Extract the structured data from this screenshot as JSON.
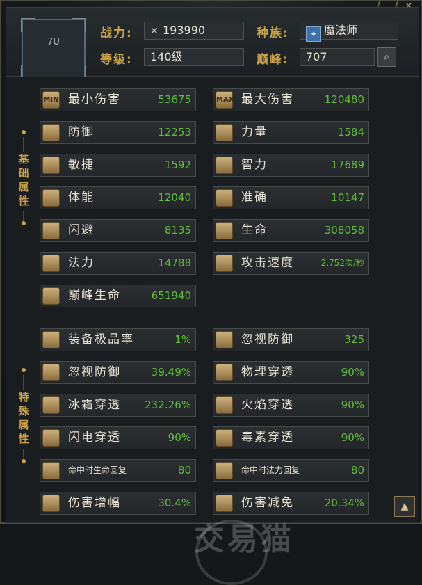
{
  "header": {
    "avatar_label": "7U",
    "power_label": "战力:",
    "power_value": "193990",
    "race_label": "种族:",
    "race_value": "魔法师",
    "level_label": "等级:",
    "level_value": "140级",
    "peak_label": "巅峰:",
    "peak_value": "707"
  },
  "sections": {
    "basic_tag": [
      "基",
      "础",
      "属",
      "性"
    ],
    "special_tag": [
      "特",
      "殊",
      "属",
      "性"
    ]
  },
  "basic_stats": [
    {
      "icon": "min-damage-icon",
      "icon_text": "MIN",
      "name": "最小伤害",
      "value": "53675"
    },
    {
      "icon": "max-damage-icon",
      "icon_text": "MAX",
      "name": "最大伤害",
      "value": "120480"
    },
    {
      "icon": "defense-icon",
      "icon_text": "",
      "name": "防御",
      "value": "12253"
    },
    {
      "icon": "strength-icon",
      "icon_text": "",
      "name": "力量",
      "value": "1584"
    },
    {
      "icon": "agility-icon",
      "icon_text": "",
      "name": "敏捷",
      "value": "1592"
    },
    {
      "icon": "intelligence-icon",
      "icon_text": "",
      "name": "智力",
      "value": "17689"
    },
    {
      "icon": "stamina-icon",
      "icon_text": "",
      "name": "体能",
      "value": "12040"
    },
    {
      "icon": "accuracy-icon",
      "icon_text": "",
      "name": "准确",
      "value": "10147"
    },
    {
      "icon": "dodge-icon",
      "icon_text": "",
      "name": "闪避",
      "value": "8135"
    },
    {
      "icon": "life-icon",
      "icon_text": "",
      "name": "生命",
      "value": "308058"
    },
    {
      "icon": "mana-icon",
      "icon_text": "",
      "name": "法力",
      "value": "14788"
    },
    {
      "icon": "attack-speed-icon",
      "icon_text": "",
      "name": "攻击速度",
      "value": "2.752次/秒"
    },
    {
      "icon": "peak-life-icon",
      "icon_text": "",
      "name": "巅峰生命",
      "value": "651940"
    }
  ],
  "special_stats": [
    {
      "icon": "equipment-rate-icon",
      "name": "装备极品率",
      "value": "1%"
    },
    {
      "icon": "ignore-defense-icon",
      "name": "忽视防御",
      "value": "325"
    },
    {
      "icon": "ignore-defense-pct-icon",
      "name": "忽视防御",
      "value": "39.49%"
    },
    {
      "icon": "physical-pierce-icon",
      "name": "物理穿透",
      "value": "90%"
    },
    {
      "icon": "frost-pierce-icon",
      "name": "冰霜穿透",
      "value": "232.26%"
    },
    {
      "icon": "fire-pierce-icon",
      "name": "火焰穿透",
      "value": "90%"
    },
    {
      "icon": "lightning-pierce-icon",
      "name": "闪电穿透",
      "value": "90%"
    },
    {
      "icon": "poison-pierce-icon",
      "name": "毒素穿透",
      "value": "90%"
    },
    {
      "icon": "life-on-hit-icon",
      "name": "命中时生命回复",
      "value": "80"
    },
    {
      "icon": "mana-on-hit-icon",
      "name": "命中时法力回复",
      "value": "80"
    },
    {
      "icon": "damage-boost-icon",
      "name": "伤害增幅",
      "value": "30.4%"
    },
    {
      "icon": "damage-reduction-icon",
      "name": "伤害减免",
      "value": "20.34%"
    }
  ],
  "watermark": "交易猫"
}
